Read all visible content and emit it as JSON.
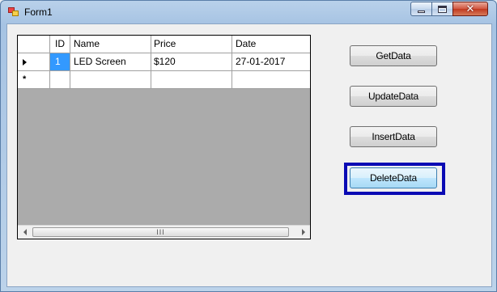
{
  "window": {
    "title": "Form1",
    "controls": {
      "minimize": "minimize",
      "maximize": "maximize",
      "close": "✕"
    }
  },
  "grid": {
    "columns": [
      "ID",
      "Name",
      "Price",
      "Date"
    ],
    "rows": [
      {
        "id": "1",
        "name": "LED Screen",
        "price": "$120",
        "date": "27-01-2017"
      }
    ],
    "new_row_marker": "*",
    "scroll_grip": "III"
  },
  "buttons": {
    "get": "GetData",
    "update": "UpdateData",
    "insert": "InsertData",
    "delete": "DeleteData"
  },
  "colors": {
    "selection": "#3399ff",
    "focus_highlight": "#0a0ab4"
  }
}
